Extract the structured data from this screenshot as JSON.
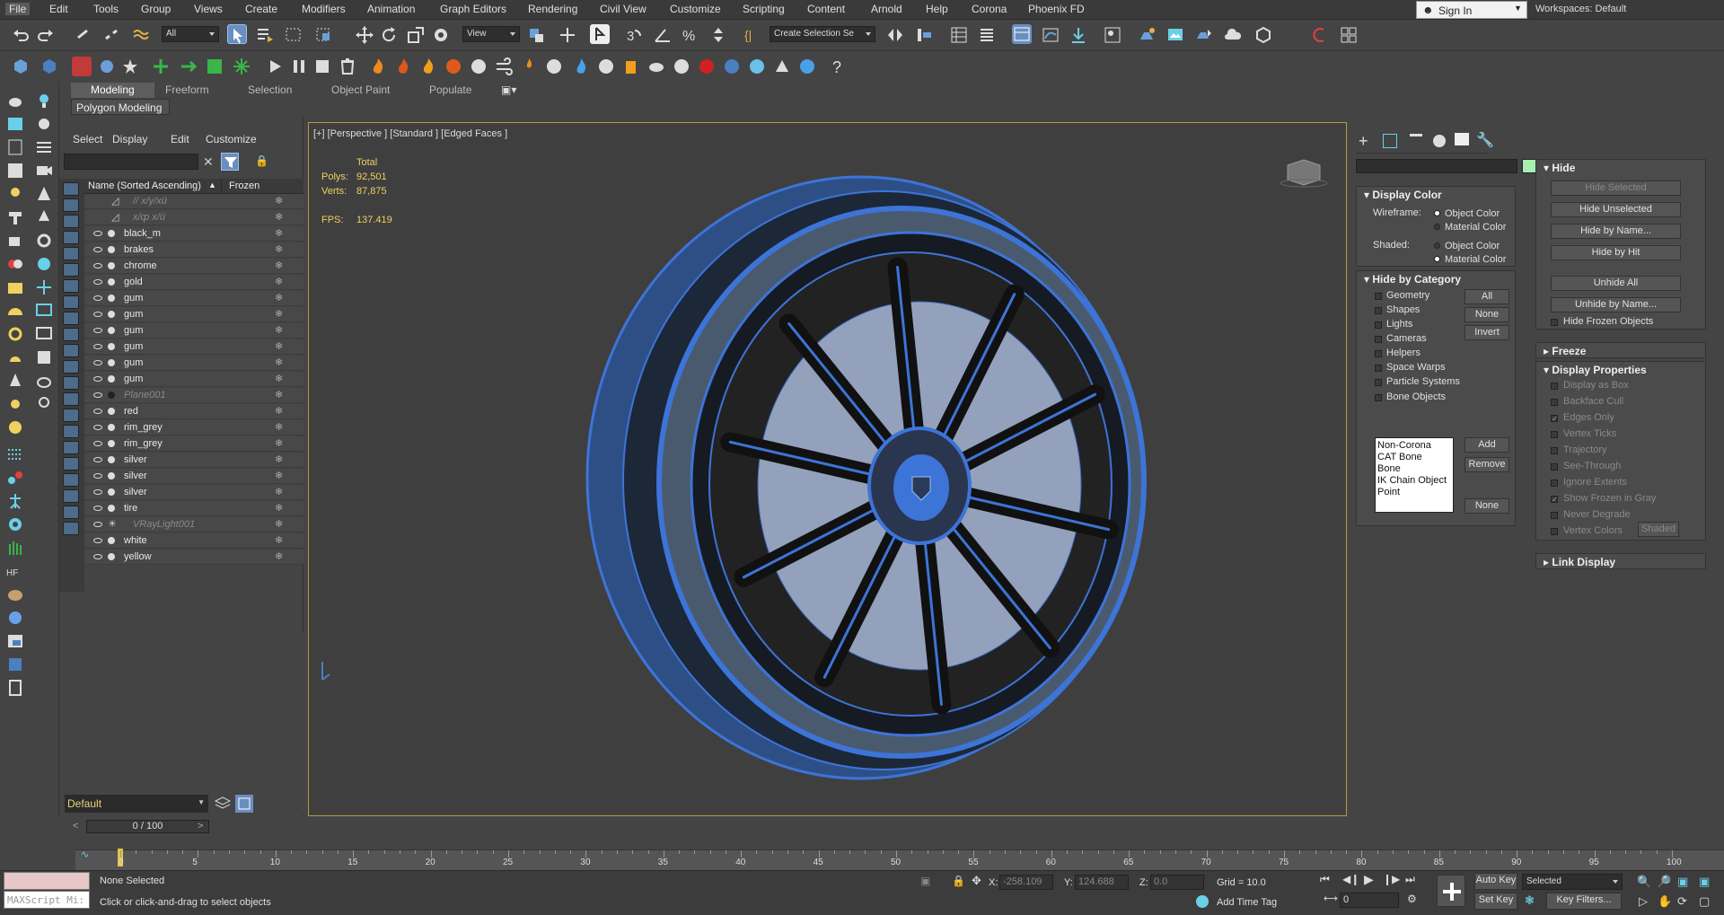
{
  "menubar": {
    "items": [
      "File",
      "Edit",
      "Tools",
      "Group",
      "Views",
      "Create",
      "Modifiers",
      "Animation",
      "Graph Editors",
      "Rendering",
      "Civil View",
      "Customize",
      "Scripting",
      "Content",
      "Arnold",
      "Help",
      "Corona",
      "Phoenix FD"
    ],
    "sign_in": "Sign In",
    "workspace_label": "Workspaces:",
    "workspace_value": "Default"
  },
  "toolbar": {
    "filter_value": "All",
    "view_value": "View",
    "selection_set_value": "Create Selection Se"
  },
  "ribbon": {
    "tabs": [
      "Modeling",
      "Freeform",
      "Selection",
      "Object Paint",
      "Populate"
    ],
    "active_tab": "Modeling",
    "panel_label": "Polygon Modeling"
  },
  "explorer": {
    "menu": [
      "Select",
      "Display",
      "Edit",
      "Customize"
    ],
    "col_name": "Name (Sorted Ascending)",
    "col_frozen": "Frozen",
    "sort_indicator": "▲",
    "rows": [
      {
        "name": "// x/y/xü",
        "dim": true,
        "type": "bone"
      },
      {
        "name": "x/ȹ x/ü",
        "dim": true,
        "type": "bone"
      },
      {
        "name": "black_m"
      },
      {
        "name": "brakes"
      },
      {
        "name": "chrome"
      },
      {
        "name": "gold"
      },
      {
        "name": "gum"
      },
      {
        "name": "gum"
      },
      {
        "name": "gum"
      },
      {
        "name": "gum"
      },
      {
        "name": "gum"
      },
      {
        "name": "gum"
      },
      {
        "name": "Plane001",
        "dim": true
      },
      {
        "name": "red"
      },
      {
        "name": "rim_grey"
      },
      {
        "name": "rim_grey"
      },
      {
        "name": "silver"
      },
      {
        "name": "silver"
      },
      {
        "name": "silver"
      },
      {
        "name": "tire"
      },
      {
        "name": "VRayLight001",
        "dim": true,
        "type": "light"
      },
      {
        "name": "white"
      },
      {
        "name": "yellow"
      }
    ],
    "layer_value": "Default"
  },
  "viewport": {
    "label": "[+] [Perspective ] [Standard ] [Edged Faces ]",
    "total_label": "Total",
    "polys_label": "Polys:",
    "polys_value": "92,501",
    "verts_label": "Verts:",
    "verts_value": "87,875",
    "fps_label": "FPS:",
    "fps_value": "137.419",
    "wire_color": "#3d74d8"
  },
  "command_panel": {
    "display_color": {
      "title": "Display Color",
      "wireframe_label": "Wireframe:",
      "shaded_label": "Shaded:",
      "object_color": "Object Color",
      "material_color": "Material Color"
    },
    "hide_by_category": {
      "title": "Hide by Category",
      "items": [
        "Geometry",
        "Shapes",
        "Lights",
        "Cameras",
        "Helpers",
        "Space Warps",
        "Particle Systems",
        "Bone Objects"
      ],
      "all_btn": "All",
      "none_btn": "None",
      "invert_btn": "Invert",
      "list": [
        "Non-Corona",
        "CAT Bone",
        "Bone",
        "IK Chain Object",
        "Point"
      ],
      "add_btn": "Add",
      "remove_btn": "Remove",
      "none_btn2": "None"
    },
    "hide": {
      "title": "Hide",
      "buttons": [
        "Hide Selected",
        "Hide Unselected",
        "Hide by Name...",
        "Hide by Hit",
        "Unhide All",
        "Unhide by Name..."
      ],
      "frozen_label": "Hide Frozen Objects"
    },
    "freeze": {
      "title": "Freeze"
    },
    "display_properties": {
      "title": "Display Properties",
      "items": [
        "Display as Box",
        "Backface Cull",
        "Edges Only",
        "Vertex Ticks",
        "Trajectory",
        "See-Through",
        "Ignore Extents",
        "Show Frozen in Gray",
        "Never Degrade",
        "Vertex Colors"
      ],
      "shaded_btn": "Shaded"
    },
    "link_display": {
      "title": "Link Display"
    },
    "swatch_color": "#a8f0b0"
  },
  "timeline": {
    "slider": "0 / 100",
    "ticks": [
      "0",
      "5",
      "10",
      "15",
      "20",
      "25",
      "30",
      "35",
      "40",
      "45",
      "50",
      "55",
      "60",
      "65",
      "70",
      "75",
      "80",
      "85",
      "90",
      "95",
      "100"
    ]
  },
  "status": {
    "maxscript": "MAXScript Mi:",
    "none_selected": "None Selected",
    "prompt": "Click or click-and-drag to select objects",
    "x_label": "X:",
    "x_value": "-258.109",
    "y_label": "Y:",
    "y_value": "124.688",
    "z_label": "Z:",
    "z_value": "0.0",
    "grid": "Grid = 10.0",
    "add_time_tag": "Add Time Tag",
    "auto_key": "Auto Key",
    "set_key": "Set Key",
    "selected_value": "Selected",
    "key_filters": "Key Filters...",
    "frame_value": "0"
  }
}
